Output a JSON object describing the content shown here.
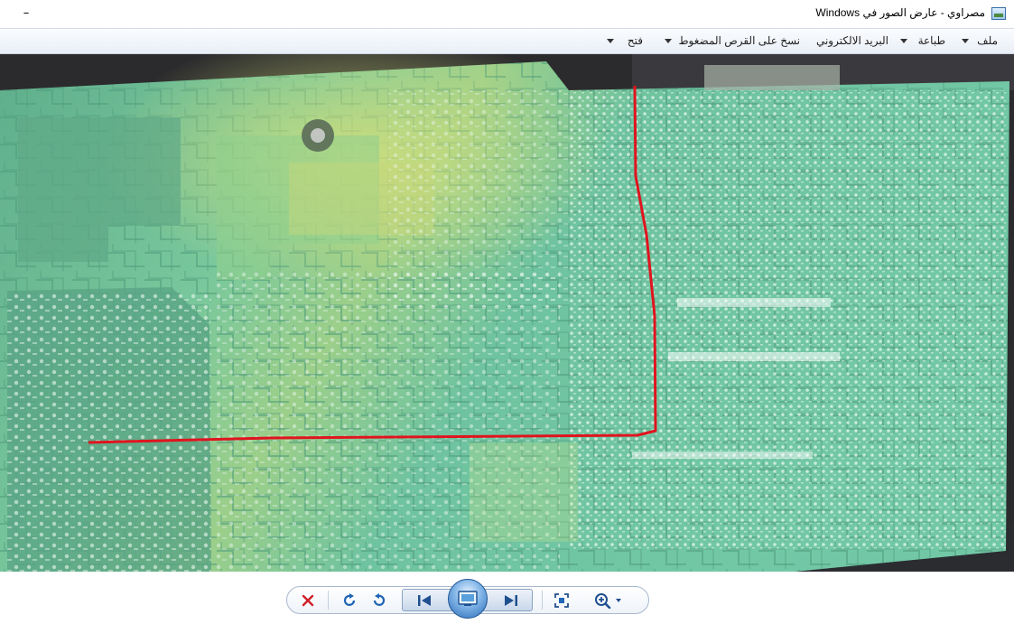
{
  "window": {
    "title": "مصراوي - عارض الصور في Windows",
    "minimize_glyph": "–"
  },
  "menu": {
    "items": [
      {
        "label": "ملف",
        "has_dropdown": true
      },
      {
        "label": "طباعة",
        "has_dropdown": true
      },
      {
        "label": "البريد الالكتروني",
        "has_dropdown": false
      },
      {
        "label": "نسخ على القرص المضغوط",
        "has_dropdown": false
      },
      {
        "label": "فتح",
        "has_dropdown": true
      }
    ]
  },
  "photo": {
    "subject": "circuit-board-photo",
    "board_color": "#6fc8a0",
    "trace_color": "#e8f5ee",
    "marker_color": "#e0141e"
  },
  "toolbar": {
    "icons": [
      "delete-icon",
      "rotate-clockwise-icon",
      "rotate-counterclockwise-icon",
      "previous-icon",
      "slideshow-icon",
      "next-icon",
      "actual-size-icon",
      "zoom-icon"
    ],
    "delete_color": "#d0202a",
    "accent_color": "#1f64b5"
  }
}
